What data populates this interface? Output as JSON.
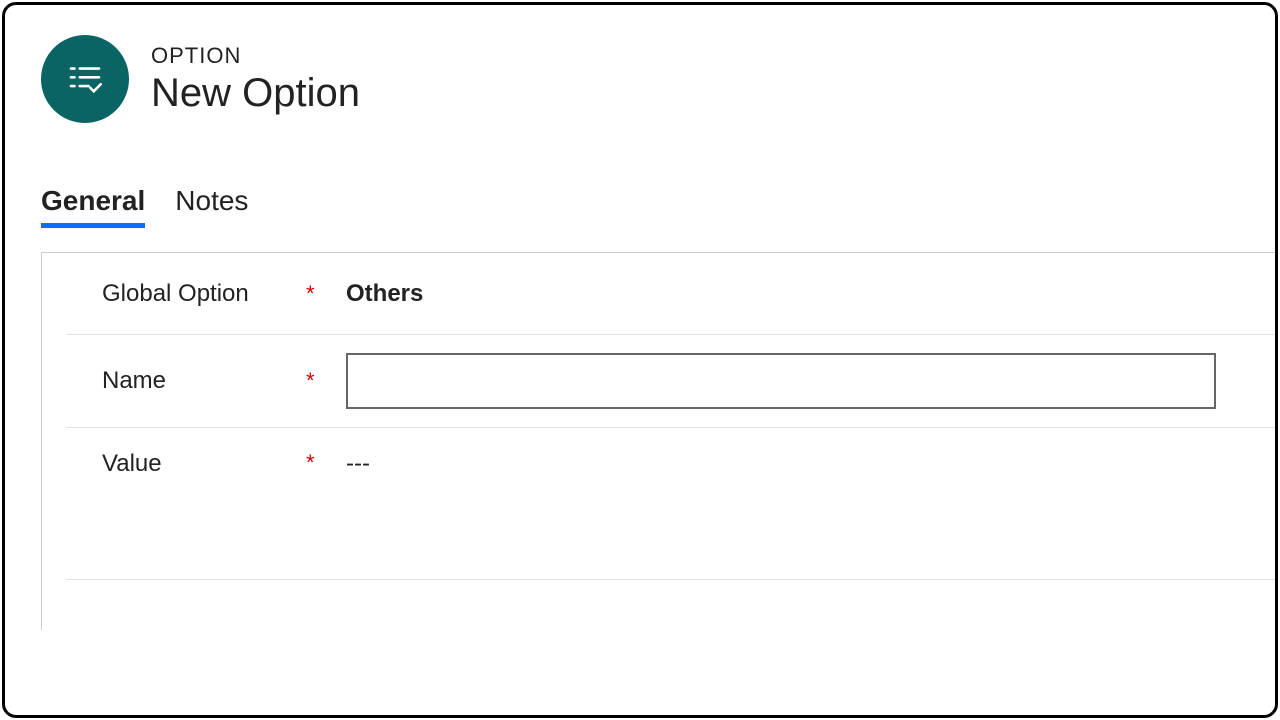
{
  "header": {
    "entity_label": "OPTION",
    "title": "New Option"
  },
  "tabs": [
    {
      "label": "General",
      "active": true
    },
    {
      "label": "Notes",
      "active": false
    }
  ],
  "form": {
    "required_marker": "*",
    "global_option": {
      "label": "Global Option",
      "value": "Others"
    },
    "name": {
      "label": "Name",
      "value": ""
    },
    "value": {
      "label": "Value",
      "value": "---"
    }
  }
}
